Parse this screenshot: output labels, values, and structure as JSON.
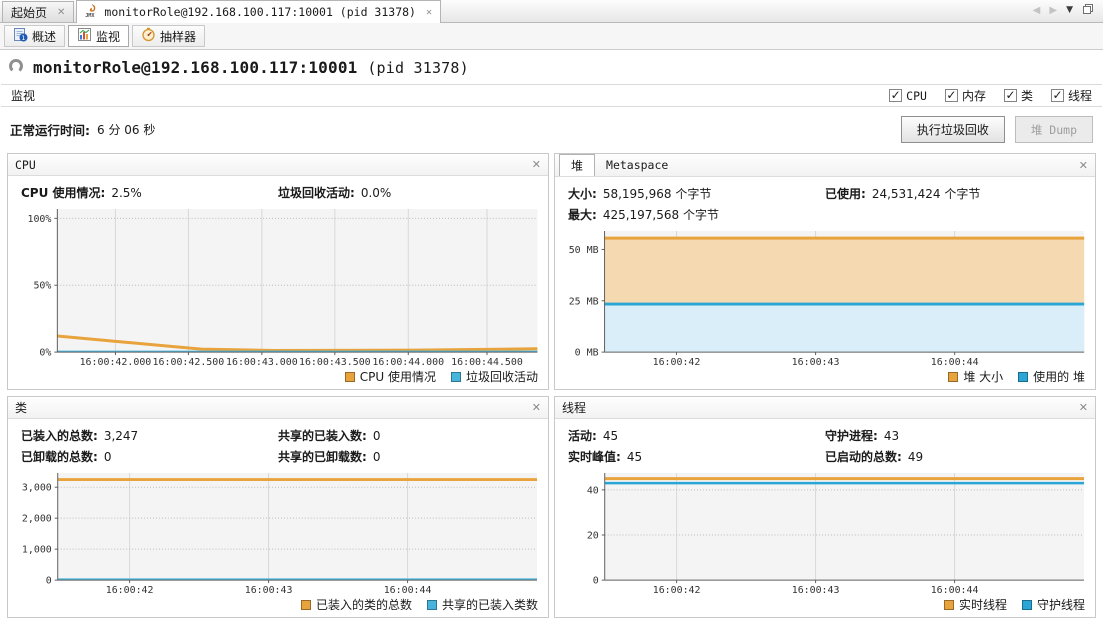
{
  "icons": {
    "close": "✕",
    "check": "✓",
    "back": "◀",
    "forward": "▶",
    "dropdown": "▼"
  },
  "window_tabs": {
    "tabs": [
      {
        "label": "起始页"
      },
      {
        "label": "monitorRole@192.168.100.117:10001 (pid 31378)"
      }
    ]
  },
  "view_tabs": [
    {
      "label": "概述"
    },
    {
      "label": "监视"
    },
    {
      "label": "抽样器"
    }
  ],
  "header": {
    "title": "monitorRole@192.168.100.117:10001",
    "title_pid": "(pid 31378)",
    "section": "监视",
    "checkboxes": [
      {
        "label": "CPU",
        "checked": true
      },
      {
        "label": "内存",
        "checked": true
      },
      {
        "label": "类",
        "checked": true
      },
      {
        "label": "线程",
        "checked": true
      }
    ],
    "uptime_label": "正常运行时间:",
    "uptime_value": "6 分 06 秒",
    "gc_button": "执行垃圾回收",
    "dump_button": "堆 Dump"
  },
  "panels": {
    "cpu": {
      "title": "CPU",
      "col1": [
        {
          "label": "CPU 使用情况:",
          "value": "2.5%"
        }
      ],
      "col2": [
        {
          "label": "垃圾回收活动:",
          "value": "0.0%"
        }
      ]
    },
    "heap": {
      "tab1": "堆",
      "tab2": "Metaspace",
      "col1": [
        {
          "label": "大小:",
          "value": "58,195,968 个字节"
        },
        {
          "label": "最大:",
          "value": "425,197,568 个字节"
        }
      ],
      "col2": [
        {
          "label": "已使用:",
          "value": "24,531,424 个字节"
        }
      ]
    },
    "classes": {
      "title": "类",
      "col1": [
        {
          "label": "已装入的总数:",
          "value": "3,247"
        },
        {
          "label": "已卸载的总数:",
          "value": "0"
        }
      ],
      "col2": [
        {
          "label": "共享的已装入数:",
          "value": "0"
        },
        {
          "label": "共享的已卸载数:",
          "value": "0"
        }
      ]
    },
    "threads": {
      "title": "线程",
      "col1": [
        {
          "label": "活动:",
          "value": "45"
        },
        {
          "label": "实时峰值:",
          "value": "45"
        }
      ],
      "col2": [
        {
          "label": "守护进程:",
          "value": "43"
        },
        {
          "label": "已启动的总数:",
          "value": "49"
        }
      ]
    }
  },
  "colors": {
    "orange": "#e8a33d",
    "blue": "#2aa6d6"
  },
  "chart_data": [
    {
      "type": "line",
      "title": "CPU",
      "ylabel": "%",
      "ylim": [
        0,
        107
      ],
      "yticks": [
        {
          "v": 0,
          "label": "0%"
        },
        {
          "v": 50,
          "label": "50%"
        },
        {
          "v": 100,
          "label": "100%"
        }
      ],
      "xticks": [
        {
          "f": 0.121,
          "label": "16:00:42.000"
        },
        {
          "f": 0.273,
          "label": "16:00:42.500"
        },
        {
          "f": 0.426,
          "label": "16:00:43.000"
        },
        {
          "f": 0.578,
          "label": "16:00:43.500"
        },
        {
          "f": 0.731,
          "label": "16:00:44.000"
        },
        {
          "f": 0.895,
          "label": "16:00:44.500"
        }
      ],
      "legend_position": "bottom-right",
      "series": [
        {
          "name": "CPU 使用情况",
          "color": "#e8a33d",
          "fill": null,
          "width": 3,
          "points": [
            [
              0,
              12
            ],
            [
              0.3,
              2.2
            ],
            [
              0.45,
              1.2
            ],
            [
              0.75,
              1.5
            ],
            [
              1,
              2.5
            ]
          ]
        },
        {
          "name": "垃圾回收活动",
          "color": "#47b4dc",
          "fill": null,
          "width": 2,
          "points": [
            [
              0,
              0.4
            ],
            [
              1,
              0.4
            ]
          ]
        }
      ]
    },
    {
      "type": "area",
      "title": "堆",
      "ylabel": "MB",
      "ylim": [
        0,
        59
      ],
      "yticks": [
        {
          "v": 0,
          "label": "0 MB"
        },
        {
          "v": 25,
          "label": "25 MB"
        },
        {
          "v": 50,
          "label": "50 MB"
        }
      ],
      "xticks": [
        {
          "f": 0.15,
          "label": "16:00:42"
        },
        {
          "f": 0.44,
          "label": "16:00:43"
        },
        {
          "f": 0.73,
          "label": "16:00:44"
        }
      ],
      "legend_position": "bottom-right",
      "series": [
        {
          "name": "堆 大小",
          "color": "#e8a33d",
          "fill": "#f5d9b0",
          "width": 3,
          "points": [
            [
              0,
              55.5
            ],
            [
              1,
              55.5
            ]
          ]
        },
        {
          "name": "使用的 堆",
          "color": "#2aa6d6",
          "fill": "#d9eef8",
          "width": 3,
          "points": [
            [
              0,
              23.4
            ],
            [
              1,
              23.4
            ]
          ]
        }
      ]
    },
    {
      "type": "line",
      "title": "类",
      "ylim": [
        0,
        3460
      ],
      "yticks": [
        {
          "v": 0,
          "label": "0"
        },
        {
          "v": 1000,
          "label": "1,000"
        },
        {
          "v": 2000,
          "label": "2,000"
        },
        {
          "v": 3000,
          "label": "3,000"
        }
      ],
      "xticks": [
        {
          "f": 0.15,
          "label": "16:00:42"
        },
        {
          "f": 0.44,
          "label": "16:00:43"
        },
        {
          "f": 0.73,
          "label": "16:00:44"
        }
      ],
      "legend_position": "bottom-right",
      "series": [
        {
          "name": "已装入的类的总数",
          "color": "#e8a33d",
          "fill": null,
          "width": 3,
          "points": [
            [
              0,
              3247
            ],
            [
              1,
              3247
            ]
          ]
        },
        {
          "name": "共享的已装入类数",
          "color": "#47b4dc",
          "fill": null,
          "width": 2,
          "points": [
            [
              0,
              25
            ],
            [
              1,
              25
            ]
          ]
        }
      ]
    },
    {
      "type": "line",
      "title": "线程",
      "ylim": [
        0,
        47.5
      ],
      "yticks": [
        {
          "v": 0,
          "label": "0"
        },
        {
          "v": 20,
          "label": "20"
        },
        {
          "v": 40,
          "label": "40"
        }
      ],
      "xticks": [
        {
          "f": 0.15,
          "label": "16:00:42"
        },
        {
          "f": 0.44,
          "label": "16:00:43"
        },
        {
          "f": 0.73,
          "label": "16:00:44"
        }
      ],
      "legend_position": "bottom-right",
      "series": [
        {
          "name": "实时线程",
          "color": "#e8a33d",
          "fill": null,
          "width": 3,
          "points": [
            [
              0,
              45
            ],
            [
              1,
              45
            ]
          ]
        },
        {
          "name": "守护线程",
          "color": "#2aa6d6",
          "fill": null,
          "width": 2.5,
          "points": [
            [
              0,
              43
            ],
            [
              1,
              43
            ]
          ]
        }
      ]
    }
  ]
}
